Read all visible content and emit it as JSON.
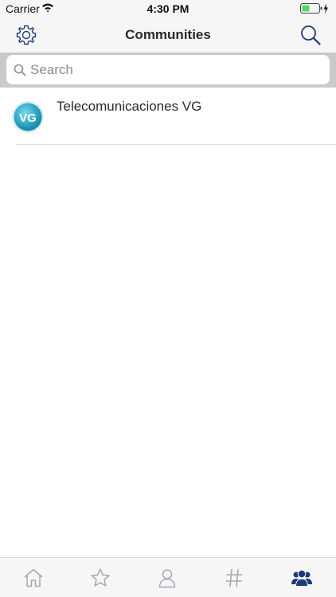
{
  "status_bar": {
    "carrier": "Carrier",
    "time": "4:30 PM",
    "wifi_icon": "wifi-icon",
    "battery_icon": "battery-charging-icon"
  },
  "nav": {
    "title": "Communities",
    "left_icon": "gear-icon",
    "right_icon": "search-icon"
  },
  "search": {
    "placeholder": "Search",
    "value": ""
  },
  "communities": [
    {
      "name": "Telecomunicaciones VG",
      "logo_text": "VG"
    }
  ],
  "tab_bar": {
    "tabs": [
      {
        "icon": "home-icon",
        "selected": false
      },
      {
        "icon": "star-icon",
        "selected": false
      },
      {
        "icon": "person-icon",
        "selected": false
      },
      {
        "icon": "hashtag-icon",
        "selected": false
      },
      {
        "icon": "communities-icon",
        "selected": true
      }
    ]
  },
  "colors": {
    "accent": "#1e3a78",
    "inactive_icon": "#a8a8ad",
    "logo_teal": "#2aa6c4"
  }
}
